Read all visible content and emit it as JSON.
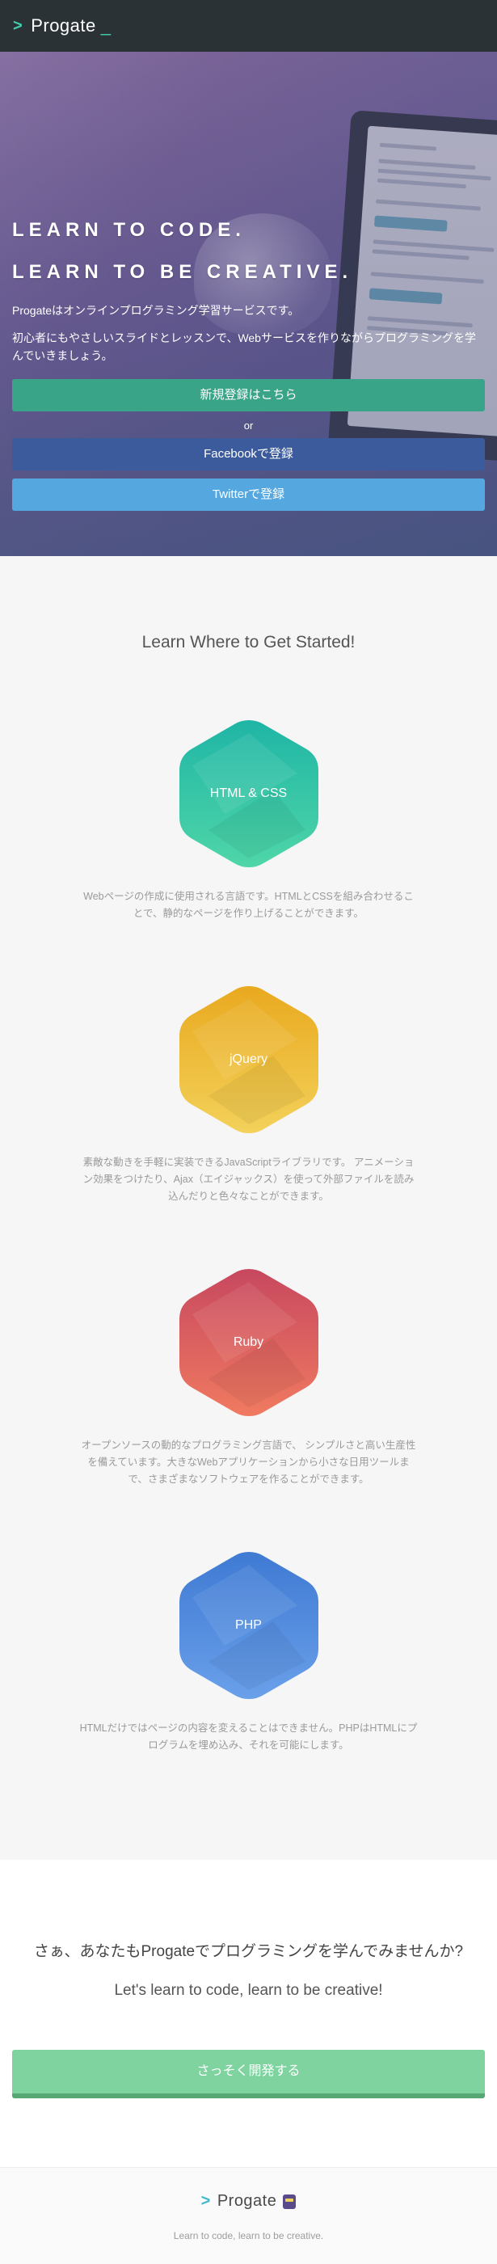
{
  "header": {
    "logo_chevron": ">",
    "logo_text": "Progate",
    "logo_cursor": "_"
  },
  "hero": {
    "headline_1": "LEARN TO CODE.",
    "headline_2": "LEARN TO BE CREATIVE.",
    "description_1": "Progateはオンラインプログラミング学習サービスです。",
    "description_2": "初心者にもやさしいスライドとレッスンで、Webサービスを作りながらプログラミングを学んでいきましょう。",
    "signup_button": "新規登録はこちら",
    "or_text": "or",
    "facebook_button": "Facebookで登録",
    "twitter_button": "Twitterで登録"
  },
  "courses": {
    "title": "Learn Where to Get Started!",
    "items": [
      {
        "name": "HTML & CSS",
        "color_top": "#1fb5a5",
        "color_bottom": "#4fd6a8",
        "description": "Webページの作成に使用される言語です。HTMLとCSSを組み合わせることで、静的なページを作り上げることができます。"
      },
      {
        "name": "jQuery",
        "color_top": "#e9a91f",
        "color_bottom": "#f3d15a",
        "description": "素敵な動きを手軽に実装できるJavaScriptライブラリです。 アニメーション効果をつけたり、Ajax（エイジャックス）を使って外部ファイルを読み込んだりと色々なことができます。"
      },
      {
        "name": "Ruby",
        "color_top": "#c7485f",
        "color_bottom": "#f07a60",
        "description": "オープンソースの動的なプログラミング言語で、 シンプルさと高い生産性を備えています。大きなWebアプリケーションから小さな日用ツールまで、さまざまなソフトウェアを作ることができます。"
      },
      {
        "name": "PHP",
        "color_top": "#3f7ad3",
        "color_bottom": "#6aa0ea",
        "description": "HTMLだけではページの内容を変えることはできません。PHPはHTMLにプログラムを埋め込み、それを可能にします。"
      }
    ]
  },
  "cta": {
    "question": "さぁ、あなたもProgateでプログラミングを学んでみませんか?",
    "english": "Let's learn to code, learn to be creative!",
    "button": "さっそく開発する"
  },
  "footer": {
    "logo_chevron": ">",
    "logo_text": "Progate",
    "tagline": "Learn to code, learn to be creative."
  }
}
